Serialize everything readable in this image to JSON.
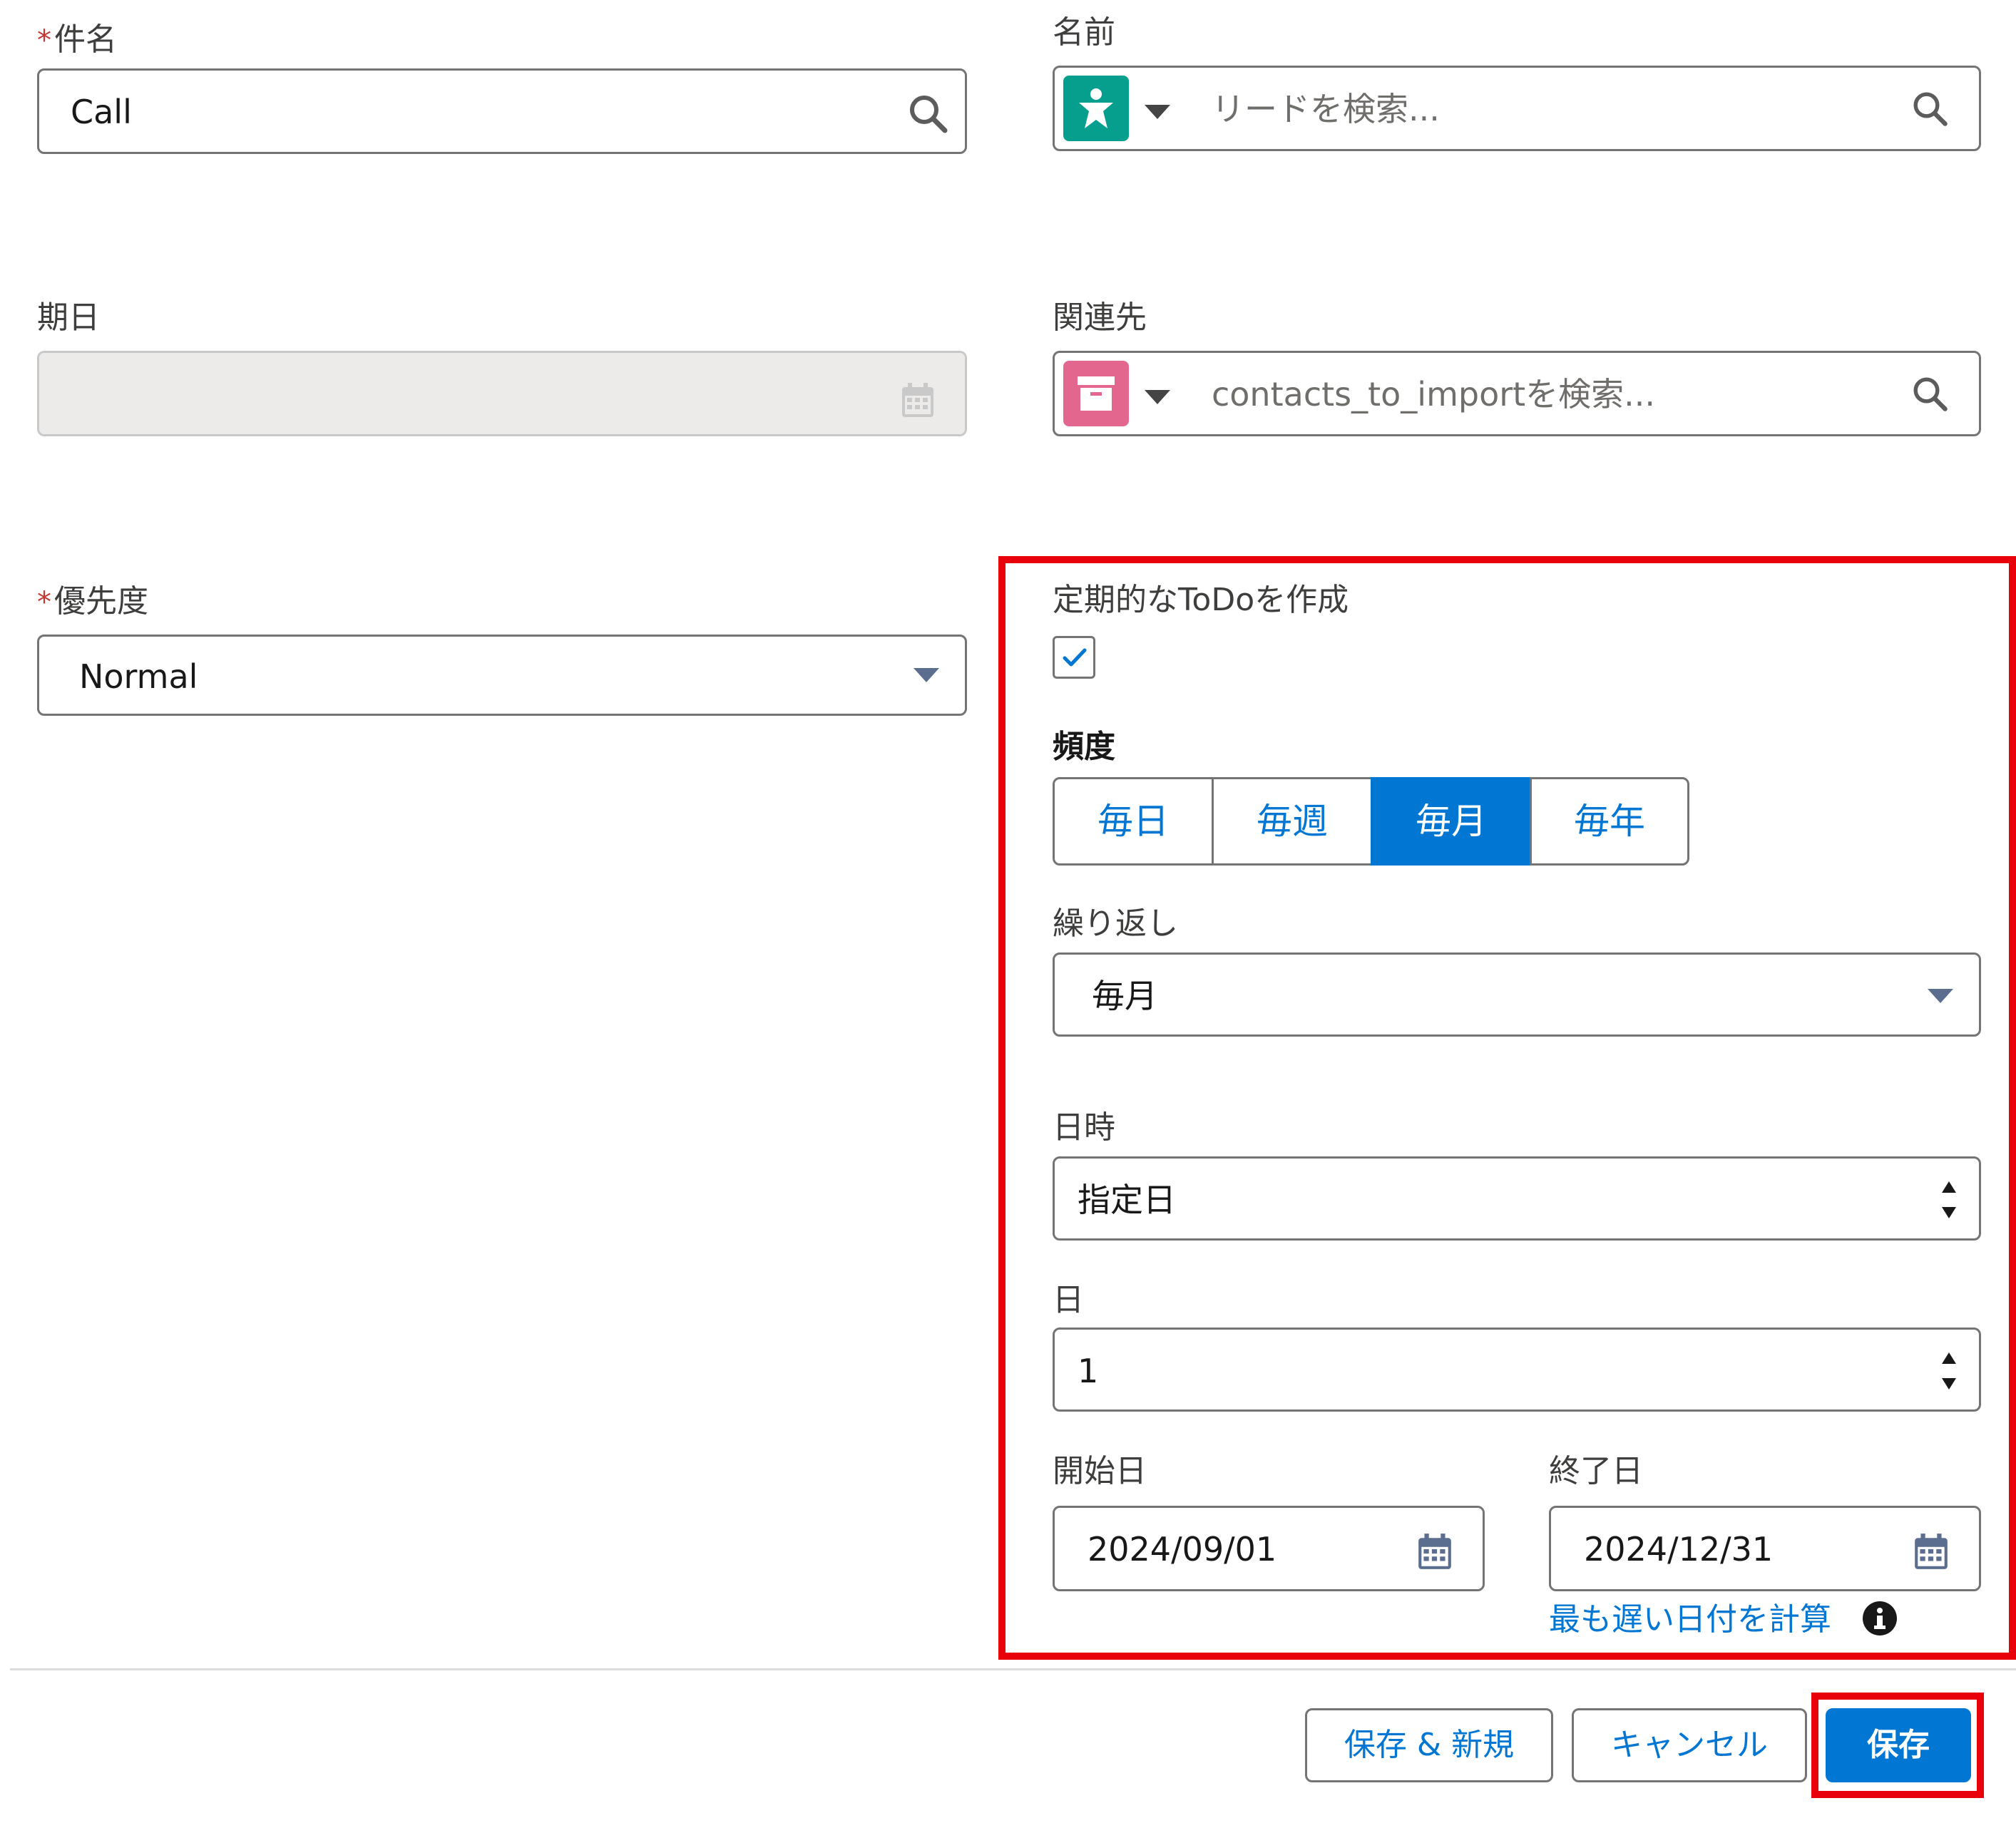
{
  "subject": {
    "required_mark": "*",
    "label": "件名",
    "value": "Call"
  },
  "name": {
    "label": "名前",
    "placeholder": "リードを検索...",
    "object_icon": "lead-icon",
    "object_icon_color": "#069e8d"
  },
  "due_date": {
    "label": "期日",
    "value": ""
  },
  "related_to": {
    "label": "関連先",
    "placeholder": "contacts_to_importを検索...",
    "object_icon": "custom-object-icon",
    "object_icon_color": "#e3668f"
  },
  "priority": {
    "required_mark": "*",
    "label": "優先度",
    "value": "Normal"
  },
  "recurrence": {
    "create_label": "定期的なToDoを作成",
    "checked": true,
    "frequency_label": "頻度",
    "frequency_options": [
      "毎日",
      "毎週",
      "毎月",
      "毎年"
    ],
    "frequency_selected": "毎月",
    "repeat_label": "繰り返し",
    "repeat_value": "毎月",
    "when_label": "日時",
    "when_value": "指定日",
    "day_label": "日",
    "day_value": "1",
    "start_label": "開始日",
    "start_value": "2024/09/01",
    "end_label": "終了日",
    "end_value": "2024/12/31",
    "calc_link": "最も遅い日付を計算"
  },
  "footer": {
    "save_new": "保存 & 新規",
    "cancel": "キャンセル",
    "save": "保存"
  },
  "colors": {
    "brand": "#0176d3",
    "highlight": "#e8000b",
    "required": "#c23934"
  }
}
